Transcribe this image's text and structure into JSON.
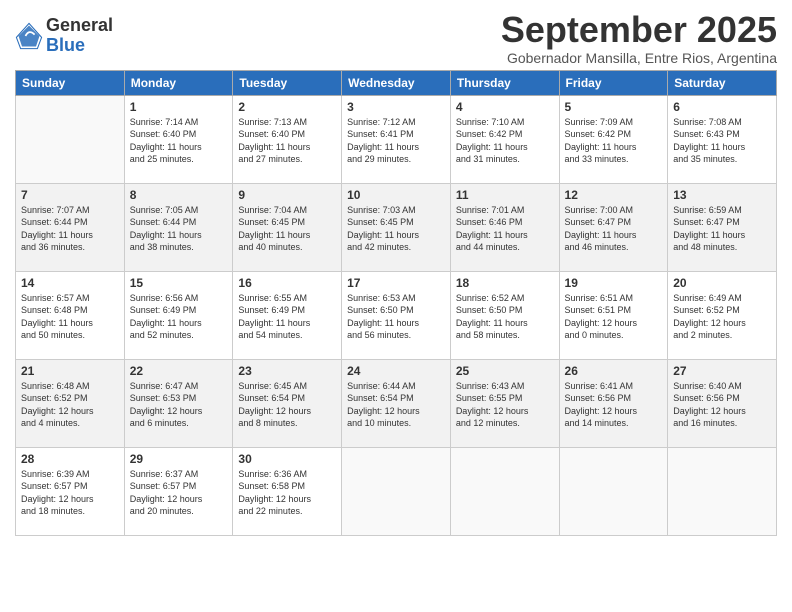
{
  "logo": {
    "general": "General",
    "blue": "Blue"
  },
  "header": {
    "month": "September 2025",
    "location": "Gobernador Mansilla, Entre Rios, Argentina"
  },
  "weekdays": [
    "Sunday",
    "Monday",
    "Tuesday",
    "Wednesday",
    "Thursday",
    "Friday",
    "Saturday"
  ],
  "weeks": [
    [
      {
        "day": "",
        "info": ""
      },
      {
        "day": "1",
        "info": "Sunrise: 7:14 AM\nSunset: 6:40 PM\nDaylight: 11 hours\nand 25 minutes."
      },
      {
        "day": "2",
        "info": "Sunrise: 7:13 AM\nSunset: 6:40 PM\nDaylight: 11 hours\nand 27 minutes."
      },
      {
        "day": "3",
        "info": "Sunrise: 7:12 AM\nSunset: 6:41 PM\nDaylight: 11 hours\nand 29 minutes."
      },
      {
        "day": "4",
        "info": "Sunrise: 7:10 AM\nSunset: 6:42 PM\nDaylight: 11 hours\nand 31 minutes."
      },
      {
        "day": "5",
        "info": "Sunrise: 7:09 AM\nSunset: 6:42 PM\nDaylight: 11 hours\nand 33 minutes."
      },
      {
        "day": "6",
        "info": "Sunrise: 7:08 AM\nSunset: 6:43 PM\nDaylight: 11 hours\nand 35 minutes."
      }
    ],
    [
      {
        "day": "7",
        "info": "Sunrise: 7:07 AM\nSunset: 6:44 PM\nDaylight: 11 hours\nand 36 minutes."
      },
      {
        "day": "8",
        "info": "Sunrise: 7:05 AM\nSunset: 6:44 PM\nDaylight: 11 hours\nand 38 minutes."
      },
      {
        "day": "9",
        "info": "Sunrise: 7:04 AM\nSunset: 6:45 PM\nDaylight: 11 hours\nand 40 minutes."
      },
      {
        "day": "10",
        "info": "Sunrise: 7:03 AM\nSunset: 6:45 PM\nDaylight: 11 hours\nand 42 minutes."
      },
      {
        "day": "11",
        "info": "Sunrise: 7:01 AM\nSunset: 6:46 PM\nDaylight: 11 hours\nand 44 minutes."
      },
      {
        "day": "12",
        "info": "Sunrise: 7:00 AM\nSunset: 6:47 PM\nDaylight: 11 hours\nand 46 minutes."
      },
      {
        "day": "13",
        "info": "Sunrise: 6:59 AM\nSunset: 6:47 PM\nDaylight: 11 hours\nand 48 minutes."
      }
    ],
    [
      {
        "day": "14",
        "info": "Sunrise: 6:57 AM\nSunset: 6:48 PM\nDaylight: 11 hours\nand 50 minutes."
      },
      {
        "day": "15",
        "info": "Sunrise: 6:56 AM\nSunset: 6:49 PM\nDaylight: 11 hours\nand 52 minutes."
      },
      {
        "day": "16",
        "info": "Sunrise: 6:55 AM\nSunset: 6:49 PM\nDaylight: 11 hours\nand 54 minutes."
      },
      {
        "day": "17",
        "info": "Sunrise: 6:53 AM\nSunset: 6:50 PM\nDaylight: 11 hours\nand 56 minutes."
      },
      {
        "day": "18",
        "info": "Sunrise: 6:52 AM\nSunset: 6:50 PM\nDaylight: 11 hours\nand 58 minutes."
      },
      {
        "day": "19",
        "info": "Sunrise: 6:51 AM\nSunset: 6:51 PM\nDaylight: 12 hours\nand 0 minutes."
      },
      {
        "day": "20",
        "info": "Sunrise: 6:49 AM\nSunset: 6:52 PM\nDaylight: 12 hours\nand 2 minutes."
      }
    ],
    [
      {
        "day": "21",
        "info": "Sunrise: 6:48 AM\nSunset: 6:52 PM\nDaylight: 12 hours\nand 4 minutes."
      },
      {
        "day": "22",
        "info": "Sunrise: 6:47 AM\nSunset: 6:53 PM\nDaylight: 12 hours\nand 6 minutes."
      },
      {
        "day": "23",
        "info": "Sunrise: 6:45 AM\nSunset: 6:54 PM\nDaylight: 12 hours\nand 8 minutes."
      },
      {
        "day": "24",
        "info": "Sunrise: 6:44 AM\nSunset: 6:54 PM\nDaylight: 12 hours\nand 10 minutes."
      },
      {
        "day": "25",
        "info": "Sunrise: 6:43 AM\nSunset: 6:55 PM\nDaylight: 12 hours\nand 12 minutes."
      },
      {
        "day": "26",
        "info": "Sunrise: 6:41 AM\nSunset: 6:56 PM\nDaylight: 12 hours\nand 14 minutes."
      },
      {
        "day": "27",
        "info": "Sunrise: 6:40 AM\nSunset: 6:56 PM\nDaylight: 12 hours\nand 16 minutes."
      }
    ],
    [
      {
        "day": "28",
        "info": "Sunrise: 6:39 AM\nSunset: 6:57 PM\nDaylight: 12 hours\nand 18 minutes."
      },
      {
        "day": "29",
        "info": "Sunrise: 6:37 AM\nSunset: 6:57 PM\nDaylight: 12 hours\nand 20 minutes."
      },
      {
        "day": "30",
        "info": "Sunrise: 6:36 AM\nSunset: 6:58 PM\nDaylight: 12 hours\nand 22 minutes."
      },
      {
        "day": "",
        "info": ""
      },
      {
        "day": "",
        "info": ""
      },
      {
        "day": "",
        "info": ""
      },
      {
        "day": "",
        "info": ""
      }
    ]
  ]
}
